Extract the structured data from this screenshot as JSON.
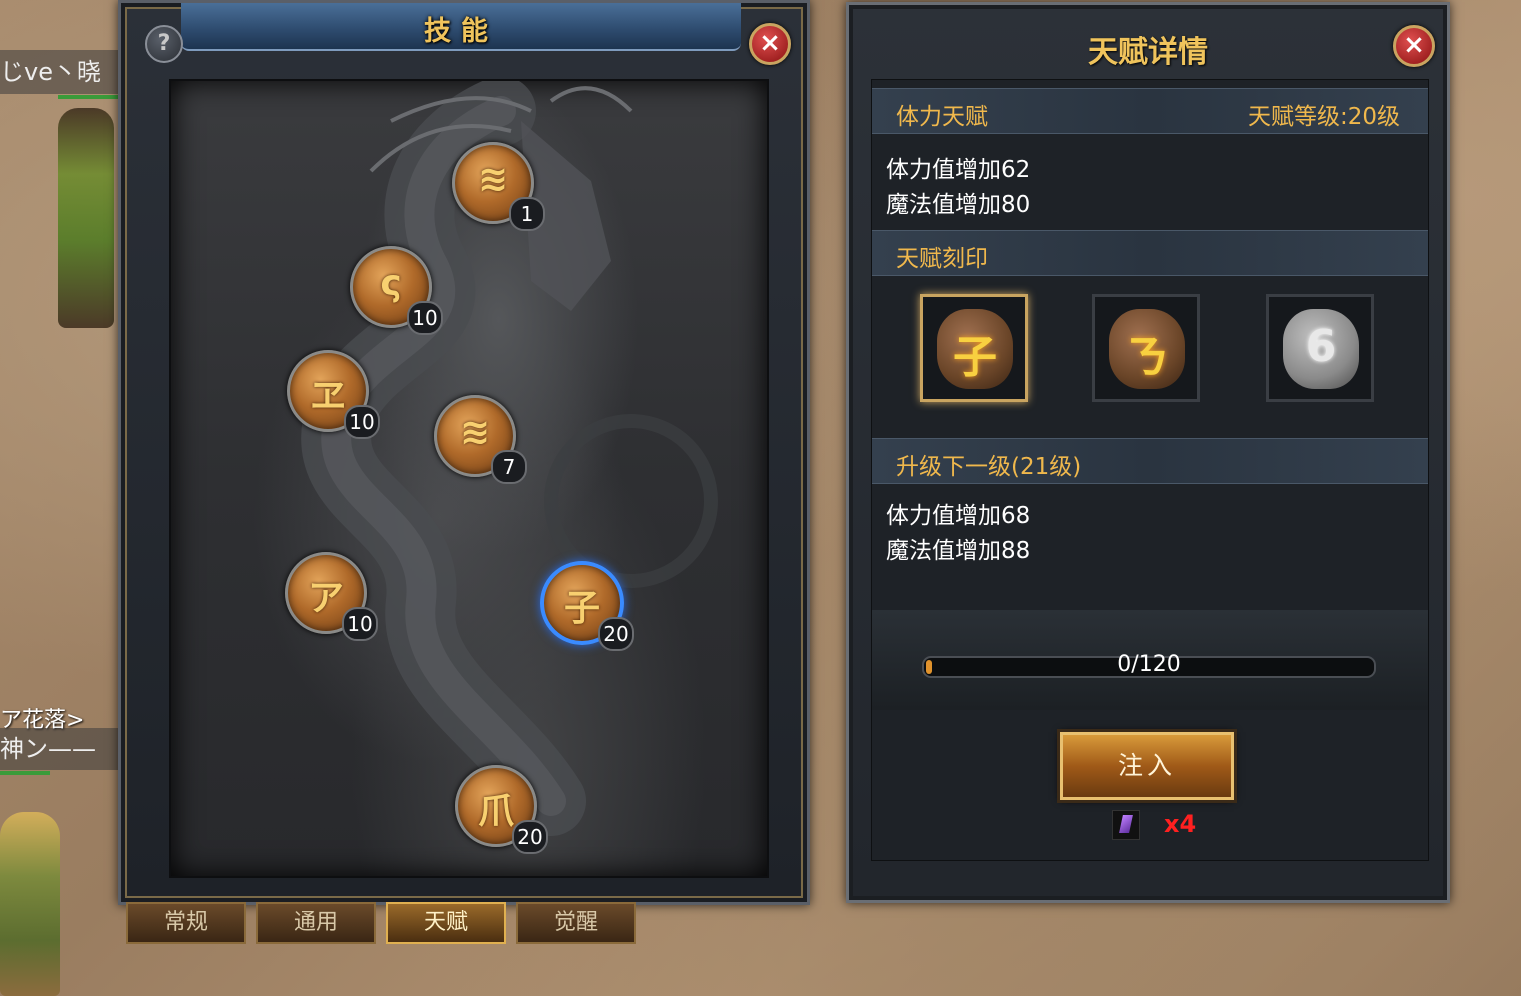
{
  "world": {
    "player_name_1": "じve丶晓",
    "guild_text": "ア花落>",
    "player_name_2": "神ン——"
  },
  "skill_panel": {
    "title": "技能",
    "help_label": "?",
    "close_label": "×",
    "nodes": [
      {
        "glyph": "≋",
        "level": "1",
        "selected": false
      },
      {
        "glyph": "ς",
        "level": "10",
        "selected": false
      },
      {
        "glyph": "ヱ",
        "level": "10",
        "selected": false
      },
      {
        "glyph": "≋",
        "level": "7",
        "selected": false
      },
      {
        "glyph": "ア",
        "level": "10",
        "selected": false
      },
      {
        "glyph": "子",
        "level": "20",
        "selected": true
      },
      {
        "glyph": "爪",
        "level": "20",
        "selected": false
      }
    ],
    "tabs": [
      "常规",
      "通用",
      "天赋",
      "觉醒"
    ],
    "active_tab": "天赋"
  },
  "detail_panel": {
    "title": "天赋详情",
    "close_label": "×",
    "talent_name": "体力天赋",
    "talent_level": "天赋等级:20级",
    "current_stats": [
      "体力值增加62",
      "魔法值增加80"
    ],
    "seal_heading": "天赋刻印",
    "seals": [
      {
        "glyph": "子",
        "style": "brown",
        "selected": true
      },
      {
        "glyph": "ㄋ",
        "style": "brown",
        "selected": false
      },
      {
        "glyph": "6",
        "style": "grey",
        "selected": false
      }
    ],
    "next_heading": "升级下一级(21级)",
    "next_stats": [
      "体力值增加68",
      "魔法值增加88"
    ],
    "progress_text": "0/120",
    "progress_value": 0,
    "progress_max": 120,
    "inject_label": "注入",
    "cost_count": "x4"
  },
  "colors": {
    "gold_text": "#f0c45c",
    "section_text": "#f0b84c",
    "selected_ring": "#3a8bff",
    "cost_red": "#ff2020"
  }
}
